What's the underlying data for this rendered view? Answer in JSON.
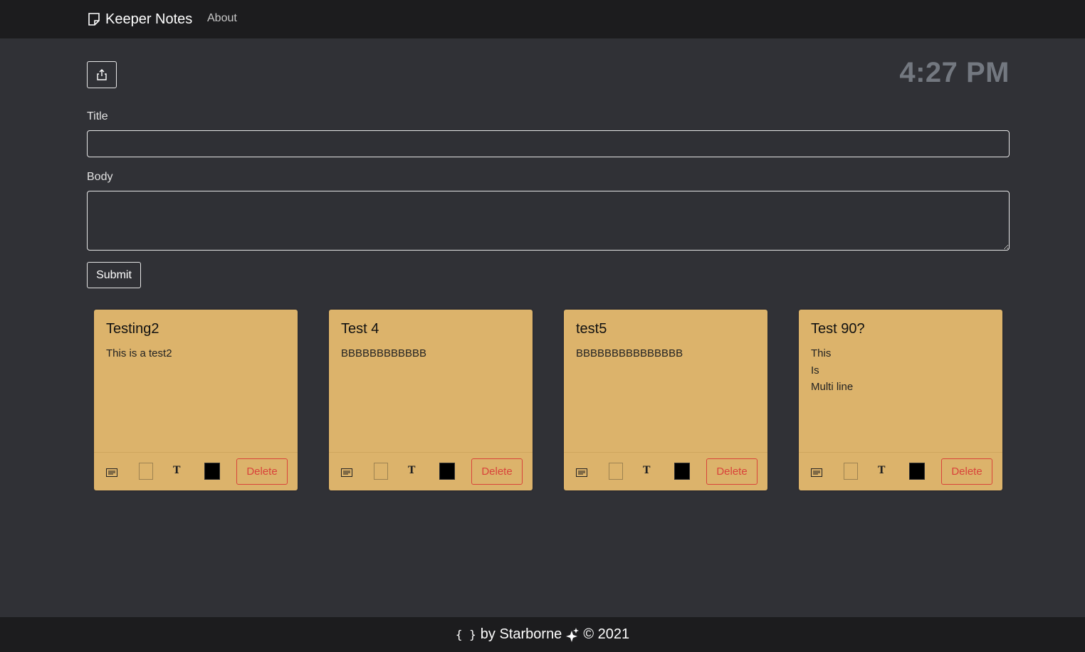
{
  "navbar": {
    "brand": "Keeper Notes",
    "brand_icon": "sticky-note-icon",
    "about": "About"
  },
  "toolbar": {
    "share_icon": "share-upload-icon",
    "clock": "4:27 PM"
  },
  "form": {
    "title_label": "Title",
    "title_value": "",
    "body_label": "Body",
    "body_value": "",
    "submit_label": "Submit"
  },
  "colors": {
    "note_bg": "#dcb36b",
    "page_bg": "#303136",
    "nav_bg": "#1c1c1e",
    "delete": "#d9433a"
  },
  "notes": [
    {
      "title": "Testing2",
      "body": "This is a test2",
      "delete_label": "Delete"
    },
    {
      "title": "Test 4",
      "body": "BBBBBBBBBBBB",
      "delete_label": "Delete"
    },
    {
      "title": "test5",
      "body": "BBBBBBBBBBBBBBB",
      "delete_label": "Delete"
    },
    {
      "title": "Test 90?",
      "body": "This\nIs\nMulti line",
      "delete_label": "Delete"
    }
  ],
  "footer": {
    "braces": "{ }",
    "text": "by Starborne",
    "sparkle_icon": "sparkle-icon",
    "copyright": "© 2021"
  }
}
